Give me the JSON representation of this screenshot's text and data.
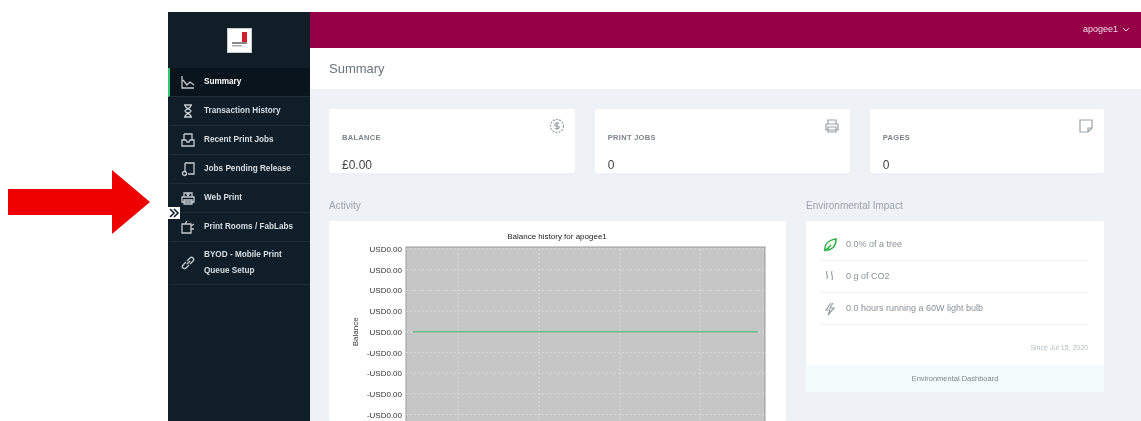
{
  "header": {
    "user": "apogee1"
  },
  "sidebar": {
    "items": [
      {
        "label": "Summary",
        "selected": true
      },
      {
        "label": "Transaction History",
        "selected": false
      },
      {
        "label": "Recent Print Jobs",
        "selected": false
      },
      {
        "label": "Jobs Pending Release",
        "selected": false
      },
      {
        "label": "Web Print",
        "selected": false
      },
      {
        "label": "Print Rooms / FabLabs",
        "selected": false
      },
      {
        "label": "BYOD - Mobile Print Queue Setup",
        "selected": false
      }
    ]
  },
  "page_title": "Summary",
  "stats": [
    {
      "label": "BALANCE",
      "value": "£0.00"
    },
    {
      "label": "PRINT JOBS",
      "value": "0"
    },
    {
      "label": "PAGES",
      "value": "0"
    }
  ],
  "activity": {
    "heading": "Activity",
    "chart": {
      "title": "Balance history for apogee1",
      "ylabel": "Balance",
      "y_labels": [
        "USD0.00",
        "USD0.00",
        "USD0.00",
        "USD0.00",
        "USD0.00",
        "-USD0.00",
        "-USD0.00",
        "-USD0.00",
        "-USD0.00"
      ]
    }
  },
  "environment": {
    "heading": "Environmental Impact",
    "items": [
      {
        "text": "0.0% of a tree"
      },
      {
        "text": "0 g of CO2"
      },
      {
        "text": "0.0 hours running a 60W light bulb"
      }
    ],
    "since": "Since Jul 15, 2020",
    "link": "Environmental Dashboard"
  }
}
